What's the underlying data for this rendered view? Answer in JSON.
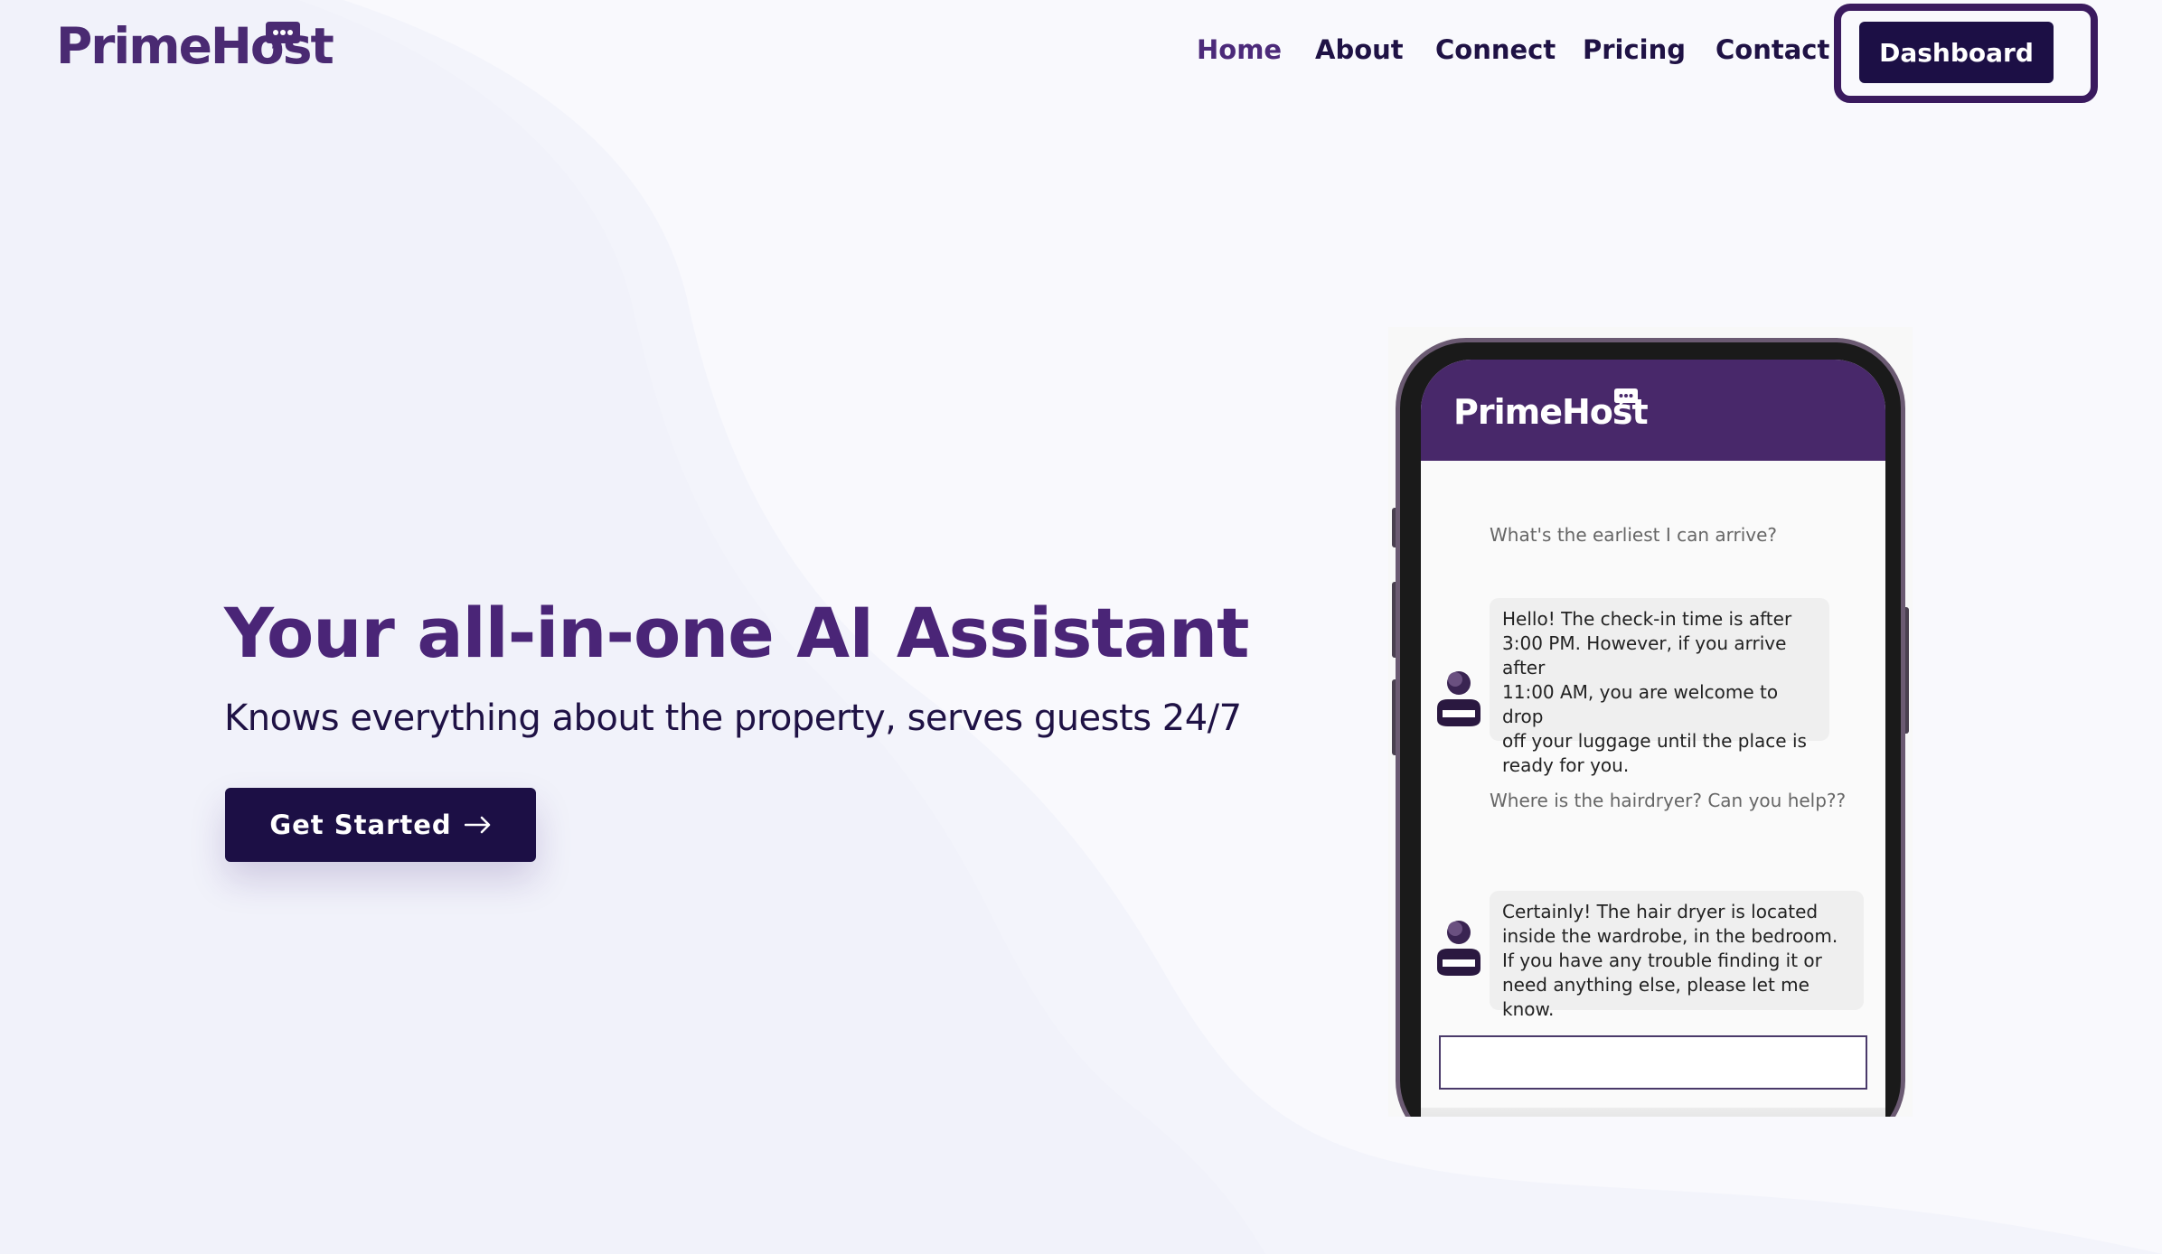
{
  "brand": {
    "name": "PrimeHost",
    "color": "#4a2a72",
    "dark": "#1c0f45"
  },
  "nav": {
    "items": [
      {
        "label": "Home",
        "active": true
      },
      {
        "label": "About"
      },
      {
        "label": "Connect"
      },
      {
        "label": "Pricing"
      },
      {
        "label": "Contact"
      }
    ],
    "dashboard_label": "Dashboard"
  },
  "hero": {
    "title": "Your all-in-one AI Assistant",
    "subtitle": "Knows everything about the property, serves guests 24/7",
    "cta_label": "Get Started",
    "cta_icon": "arrow-right-icon"
  },
  "phone": {
    "app_name": "PrimeHost",
    "messages": [
      {
        "role": "guest",
        "text": "What's the earliest I can arrive?"
      },
      {
        "role": "assistant",
        "text": "Hello! The check-in time is after\n3:00 PM. However, if you arrive after\n11:00 AM, you are welcome to drop\noff your luggage until the place is\nready for you."
      },
      {
        "role": "guest",
        "text": "Where is the hairdryer? Can you help??"
      },
      {
        "role": "assistant",
        "text": "Certainly! The hair dryer is located\ninside the wardrobe, in the bedroom.\nIf you have any trouble finding it or\nneed anything else, please let me know."
      }
    ],
    "input_value": ""
  }
}
